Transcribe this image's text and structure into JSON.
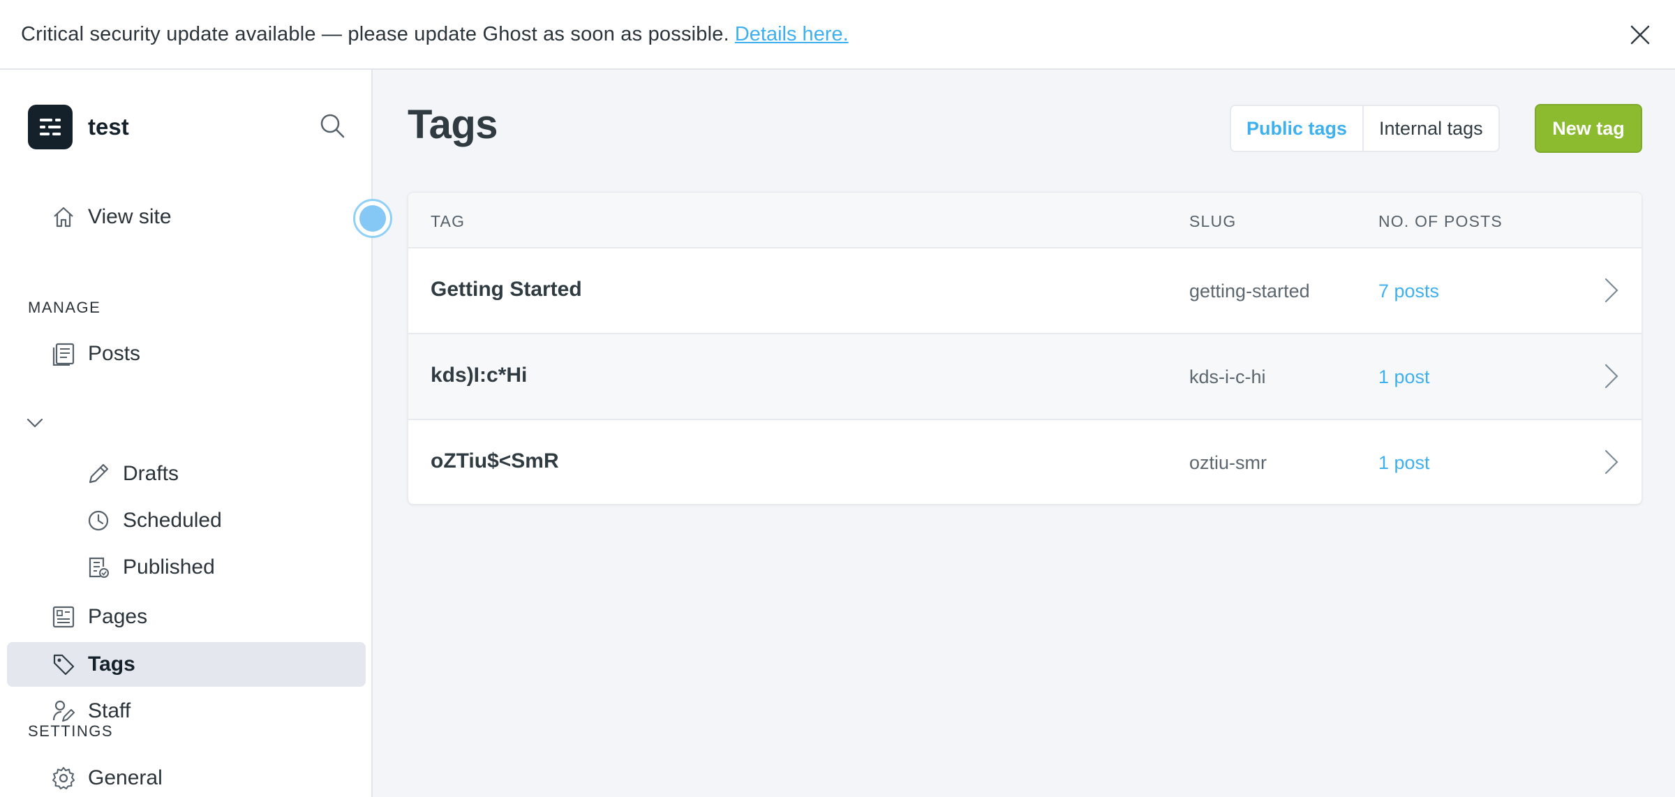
{
  "banner": {
    "message": "Critical security update available — please update Ghost as soon as possible.",
    "link_label": "Details here."
  },
  "brand": {
    "name": "test"
  },
  "sidebar": {
    "view_site": "View site",
    "manage_label": "MANAGE",
    "settings_label": "SETTINGS",
    "items": [
      {
        "label": "Posts",
        "icon": "posts-icon"
      },
      {
        "label": "Drafts",
        "icon": "pencil-icon"
      },
      {
        "label": "Scheduled",
        "icon": "clock-icon"
      },
      {
        "label": "Published",
        "icon": "published-icon"
      },
      {
        "label": "Pages",
        "icon": "pages-icon"
      },
      {
        "label": "Tags",
        "icon": "tag-icon",
        "active": true
      },
      {
        "label": "Staff",
        "icon": "staff-icon"
      },
      {
        "label": "General",
        "icon": "gear-icon"
      }
    ]
  },
  "main": {
    "title": "Tags",
    "toggle": {
      "public": "Public tags",
      "internal": "Internal tags"
    },
    "new_tag": "New tag",
    "table": {
      "headers": {
        "tag": "TAG",
        "slug": "SLUG",
        "posts": "NO. OF POSTS"
      },
      "rows": [
        {
          "name": "Getting Started",
          "slug": "getting-started",
          "count": "7 posts"
        },
        {
          "name": "kds)I:c*Hi",
          "slug": "kds-i-c-hi",
          "count": "1 post"
        },
        {
          "name": "oZTiu$<SmR",
          "slug": "oztiu-smr",
          "count": "1 post"
        }
      ]
    }
  },
  "colors": {
    "accent_blue": "#3eb0ef",
    "new_tag_green": "#8cbb2f",
    "active_nav_bg": "#e4e8ee",
    "brand_dark": "#15212a"
  }
}
